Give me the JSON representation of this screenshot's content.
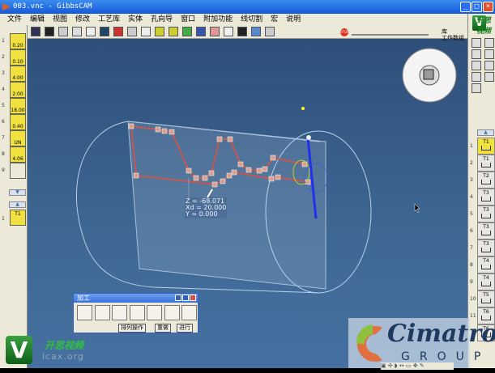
{
  "window": {
    "title": "003.vnc - GibbsCAM",
    "minimize": "_",
    "maximize": "□",
    "close": "×"
  },
  "menu": [
    "文件",
    "编辑",
    "视图",
    "修改",
    "工艺库",
    "实体",
    "孔向导",
    "窗口",
    "附加功能",
    "线切割",
    "宏",
    "说明"
  ],
  "toolbar": {
    "stop_label": "STOP",
    "right_labels": [
      "库",
      "工作数组"
    ]
  },
  "tool_list": {
    "tools": [
      {
        "num": "1",
        "value": "0.20"
      },
      {
        "num": "2",
        "value": "0.10"
      },
      {
        "num": "3",
        "value": "4.00"
      },
      {
        "num": "4",
        "value": "2.00"
      },
      {
        "num": "5",
        "value": "18.00"
      },
      {
        "num": "6",
        "value": "0.40"
      },
      {
        "num": "7",
        "value": "UN"
      },
      {
        "num": "8",
        "value": "4.06"
      },
      {
        "num": "9",
        "value": ""
      }
    ],
    "process_slot": {
      "num": "1",
      "label": "T1"
    }
  },
  "operations": [
    {
      "num": "1",
      "label": "T1"
    },
    {
      "num": "2",
      "label": "T1"
    },
    {
      "num": "3",
      "label": "T2"
    },
    {
      "num": "4",
      "label": "T3"
    },
    {
      "num": "5",
      "label": "T3"
    },
    {
      "num": "6",
      "label": "T3"
    },
    {
      "num": "7",
      "label": "T3"
    },
    {
      "num": "8",
      "label": "T4"
    },
    {
      "num": "9",
      "label": "T4"
    },
    {
      "num": "10",
      "label": "T5"
    },
    {
      "num": "11",
      "label": "T6"
    },
    {
      "num": "",
      "label": "T6"
    }
  ],
  "readout": {
    "z": "Z = -68.071",
    "xd": "Xd = 20.000",
    "y": "Y = 0.000"
  },
  "process_dialog": {
    "title": "加工",
    "sort_button": "排列操作",
    "redo_button": "重做",
    "run_button": "进行"
  },
  "watermark": {
    "vlogo_text": "开思视频",
    "vlogo_url": "icax.org",
    "top_text": "开思视频",
    "cimatron": "Cimatron",
    "group": "GROUP"
  },
  "colors": {
    "canvas": "#3e6893",
    "toolpath": "#e05040",
    "tool_yellow": "#f0e040"
  }
}
